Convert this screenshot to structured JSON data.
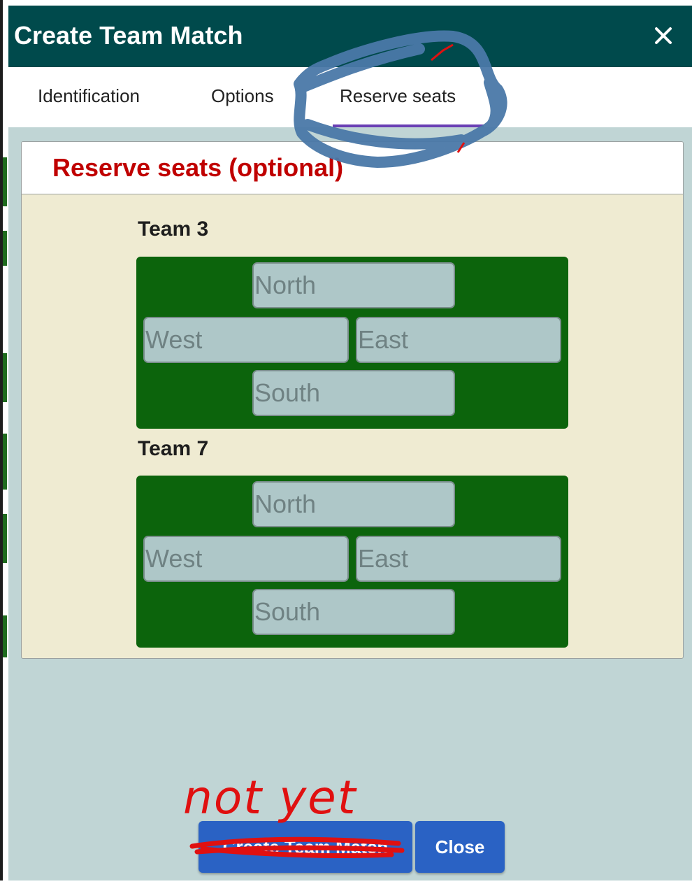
{
  "dialog": {
    "title": "Create Team Match",
    "close_icon": "close-icon"
  },
  "tabs": [
    {
      "label": "Identification",
      "active": false
    },
    {
      "label": "Options",
      "active": false
    },
    {
      "label": "Reserve seats",
      "active": true
    }
  ],
  "panel": {
    "title": "Reserve seats (optional)",
    "teams": [
      {
        "label": "Team 3",
        "seats": {
          "north": "North",
          "west": "West",
          "east": "East",
          "south": "South"
        }
      },
      {
        "label": "Team 7",
        "seats": {
          "north": "North",
          "west": "West",
          "east": "East",
          "south": "South"
        }
      }
    ]
  },
  "footer": {
    "create_label": "Create Team Match",
    "close_label": "Close"
  },
  "annotation": {
    "note": "not yet",
    "ink_colors": {
      "circle": "#4a78a8",
      "strike": "#e01010"
    }
  },
  "colors": {
    "titlebar": "#004a4c",
    "table_felt": "#0c640c",
    "panel_title": "#c00000",
    "button": "#2a62c4",
    "tab_underline": "#6a3fb4"
  }
}
